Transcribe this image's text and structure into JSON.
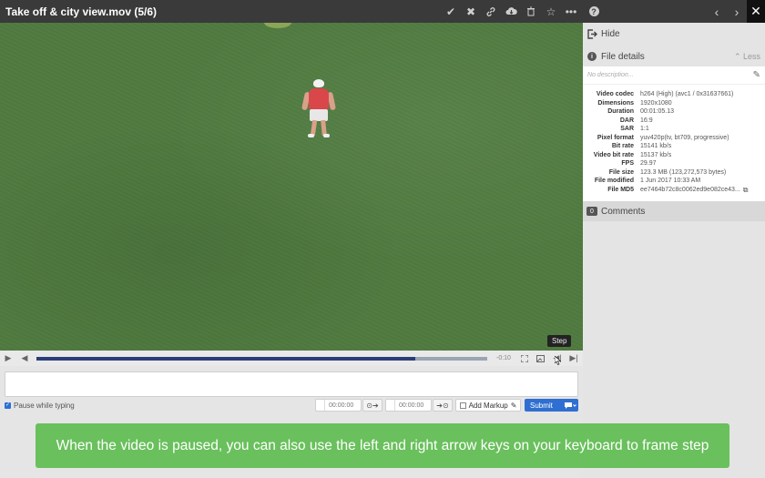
{
  "header": {
    "title": "Take off & city view.mov (5/6)"
  },
  "toolbar_icons": [
    "check-icon",
    "x-icon",
    "link-icon",
    "cloud-download-icon",
    "trash-icon",
    "star-icon",
    "more-icon"
  ],
  "player": {
    "time_remaining": "-0:10",
    "progress": 0.84,
    "tooltip": "Step"
  },
  "comment": {
    "pause_label": "Pause while typing",
    "in_time": "00:00:00",
    "out_time": "00:00:00",
    "add_markup_label": "Add Markup",
    "submit_label": "Submit"
  },
  "sidebar": {
    "hide_label": "Hide",
    "file_details_label": "File details",
    "less_label": "Less",
    "description_placeholder": "No description...",
    "details": [
      {
        "key": "Video codec",
        "value": "h264 (High) (avc1 / 0x31637661)"
      },
      {
        "key": "Dimensions",
        "value": "1920x1080"
      },
      {
        "key": "Duration",
        "value": "00:01:05.13"
      },
      {
        "key": "DAR",
        "value": "16:9"
      },
      {
        "key": "SAR",
        "value": "1:1"
      },
      {
        "key": "Pixel format",
        "value": "yuv420p(tv, bt709, progressive)"
      },
      {
        "key": "Bit rate",
        "value": "15141 kb/s"
      },
      {
        "key": "Video bit rate",
        "value": "15137 kb/s"
      },
      {
        "key": "FPS",
        "value": "29.97"
      },
      {
        "key": "File size",
        "value": "123.3 MB (123,272,573 bytes)"
      },
      {
        "key": "File modified",
        "value": "1 Jun 2017 10:33 AM"
      },
      {
        "key": "File MD5",
        "value": "ee7464b72c8c0062ed9e082ce43..."
      }
    ],
    "comments_label": "Comments",
    "comments_count": "0"
  },
  "banner": {
    "text": "When the video is paused, you can also use the left and right arrow keys on your keyboard to frame step"
  },
  "colors": {
    "accent": "#2f6fd1",
    "banner": "#62be54",
    "progress_fill": "#2c3e78"
  }
}
